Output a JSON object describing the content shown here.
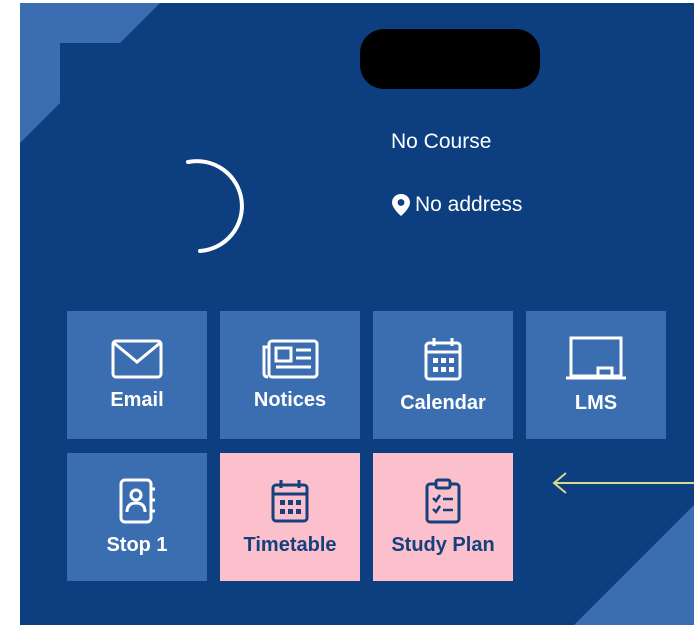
{
  "profile": {
    "course": "No Course",
    "address": "No address"
  },
  "tiles": [
    {
      "label": "Email",
      "icon": "envelope-icon",
      "highlight": false
    },
    {
      "label": "Notices",
      "icon": "newspaper-icon",
      "highlight": false
    },
    {
      "label": "Calendar",
      "icon": "calendar-icon",
      "highlight": false
    },
    {
      "label": "LMS",
      "icon": "whiteboard-icon",
      "highlight": false
    },
    {
      "label": "Stop 1",
      "icon": "contact-book-icon",
      "highlight": false
    },
    {
      "label": "Timetable",
      "icon": "calendar-icon",
      "highlight": true
    },
    {
      "label": "Study Plan",
      "icon": "clipboard-checklist-icon",
      "highlight": true
    }
  ],
  "colors": {
    "background": "#0d3f80",
    "tile": "#3a6eb0",
    "highlight_tile": "#fbc0cb",
    "highlight_text": "#14407d",
    "arrow": "#d8d98a"
  }
}
